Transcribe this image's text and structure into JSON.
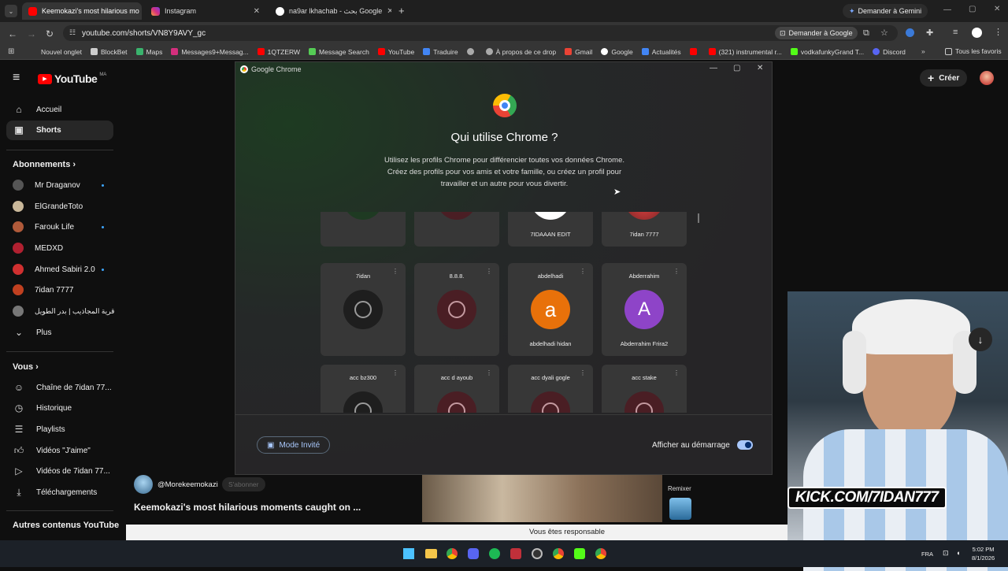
{
  "browser": {
    "tabs": [
      {
        "title": "Keemokazi's most hilarious mo"
      },
      {
        "title": "Instagram"
      },
      {
        "title": "na9ar lkhachab - بحث Google"
      }
    ],
    "gemini_button": "Demander à Gemini",
    "url": "youtube.com/shorts/VN8Y9AVY_gc",
    "ask_google": "Demander à Google",
    "bookmarks": [
      "Nouvel onglet",
      "BlockBet",
      "Maps",
      "Messages9+Messag...",
      "1QTZERW",
      "Message Search",
      "YouTube",
      "Traduire",
      "",
      "À propos de ce drop",
      "Gmail",
      "Google",
      "Actualités",
      "",
      "(321) instrumental r...",
      "vodkafunkyGrand T...",
      "Discord"
    ],
    "all_favorites": "Tous les favoris"
  },
  "youtube": {
    "logo": "YouTube",
    "logo_region": "MA",
    "create_label": "Créer",
    "nav": [
      {
        "label": "Accueil",
        "icon": "home-icon"
      },
      {
        "label": "Shorts",
        "icon": "shorts-icon"
      }
    ],
    "subscriptions_title": "Abonnements",
    "subscriptions": [
      {
        "name": "Mr Draganov",
        "dot": true,
        "color": "#444"
      },
      {
        "name": "ElGrandeToto",
        "dot": false,
        "color": "#c9b89a"
      },
      {
        "name": "Farouk Life",
        "dot": true,
        "color": "#b05a3a"
      },
      {
        "name": "MEDXD",
        "dot": false,
        "color": "#b02030"
      },
      {
        "name": "Ahmed Sabiri 2.0",
        "dot": true,
        "color": "#d03030"
      },
      {
        "name": "7idan 7777",
        "dot": false,
        "color": "#c04020"
      },
      {
        "name": "قرية المجاذيب | بدر الطويل",
        "dot": false,
        "color": "#777"
      }
    ],
    "more_label": "Plus",
    "you_title": "Vous",
    "you_items": [
      {
        "label": "Chaîne de 7idan 77...",
        "icon": "user-icon"
      },
      {
        "label": "Historique",
        "icon": "history-icon"
      },
      {
        "label": "Playlists",
        "icon": "playlist-icon"
      },
      {
        "label": "Vidéos \"J'aime\"",
        "icon": "like-icon"
      },
      {
        "label": "Vidéos de 7idan 77...",
        "icon": "video-icon"
      },
      {
        "label": "Téléchargements",
        "icon": "download-icon"
      }
    ],
    "other_title": "Autres contenus YouTube",
    "short_channel": "@Morekeemokazi",
    "subscribe_label": "S'abonner",
    "short_title": "Keemokazi's most hilarious moments caught on ...",
    "remix_label": "Remixer",
    "responsible_banner": "Vous êtes responsable"
  },
  "dialog": {
    "window_title": "Google Chrome",
    "heading": "Qui utilise Chrome ?",
    "description_lines": [
      "Utilisez les profils Chrome pour différencier toutes vos données Chrome.",
      "Créez des profils pour vos amis et votre famille, ou créez un profil pour",
      "travailler et un autre pour vous divertir."
    ],
    "top_row": [
      {
        "name": "",
        "avatar": "green"
      },
      {
        "name": "",
        "avatar": "maroon"
      },
      {
        "name": "7IDAAAN EDIT",
        "avatar": "white"
      },
      {
        "name": "7idan 7777",
        "avatar": "photo"
      }
    ],
    "profiles": [
      {
        "title": "7idan",
        "sub": "",
        "avatar": "default",
        "letter": ""
      },
      {
        "title": "8.8.8.",
        "sub": "",
        "avatar": "maroon",
        "letter": ""
      },
      {
        "title": "abdelhadi",
        "sub": "abdelhadi hidan",
        "avatar": "orange",
        "letter": "a"
      },
      {
        "title": "Abderrahim",
        "sub": "Abderrahim Frira2",
        "avatar": "purple",
        "letter": "A"
      }
    ],
    "bottom_row": [
      {
        "title": "acc bz300",
        "avatar": "default"
      },
      {
        "title": "acc d ayoub",
        "avatar": "maroon"
      },
      {
        "title": "acc dyali gogle",
        "avatar": "maroon"
      },
      {
        "title": "acc stake",
        "avatar": "maroon"
      }
    ],
    "guest_label": "Mode Invité",
    "startup_label": "Afficher au démarrage",
    "startup_enabled": true
  },
  "stream": {
    "kick_text": "KICK.COM/7IDAN777"
  },
  "system": {
    "lang": "FRA",
    "time": "5:02 PM",
    "date": "8/1/2026"
  }
}
